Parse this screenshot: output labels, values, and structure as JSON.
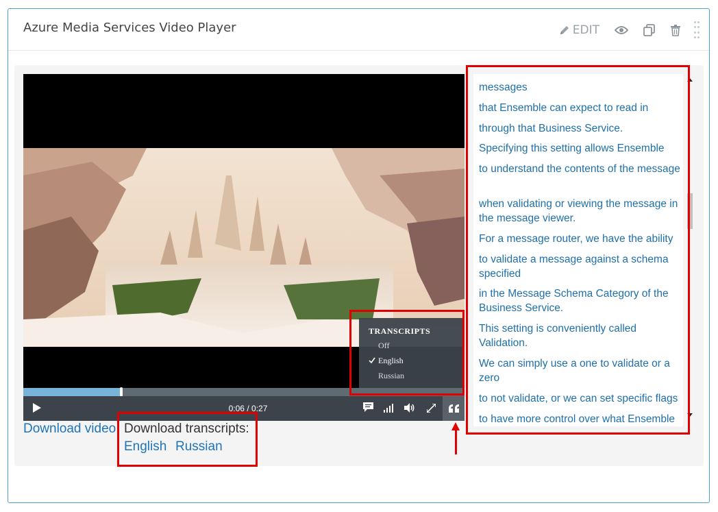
{
  "card": {
    "title": "Azure Media Services Video Player",
    "toolbar": {
      "edit_label": "EDIT",
      "icons": [
        "pencil-icon",
        "eye-icon",
        "copy-icon",
        "trash-icon",
        "drag-handle-icon"
      ]
    }
  },
  "player": {
    "progress": 0.2222,
    "time_current": "0:06",
    "time_separator": "/",
    "time_total": "0:27",
    "controls": [
      "play-icon",
      "transcript-icon",
      "quality-icon",
      "volume-icon",
      "fullscreen-icon",
      "captions-icon"
    ],
    "transcripts_menu": {
      "title": "TRANSCRIPTS",
      "items": [
        {
          "label": "Off",
          "selected": false
        },
        {
          "label": "English",
          "selected": true
        },
        {
          "label": "Russian",
          "selected": false
        }
      ]
    }
  },
  "downloads": {
    "video_link": "Download video",
    "transcripts_label": "Download transcripts:",
    "transcript_links": [
      "English",
      "Russian"
    ]
  },
  "transcript": {
    "lines": [
      "messages",
      "that Ensemble can expect to read in",
      "through that Business Service.",
      "Specifying this setting allows Ensemble",
      "to understand the contents of the message",
      "when validating or viewing the message in the message viewer.",
      "For a message router, we have the ability",
      "to validate a message against a schema specified",
      "in the Message Schema Category of the Business Service.",
      "This setting is conveniently called Validation.",
      "We can simply use a one to validate or a zero",
      "to not validate, or we can set specific flags",
      "to have more control over what Ensemble"
    ]
  },
  "colors": {
    "link": "#1f74b7",
    "highlight": "#e00000",
    "progress_fill": "#78b3da",
    "controls_bg": "#3c434a"
  }
}
